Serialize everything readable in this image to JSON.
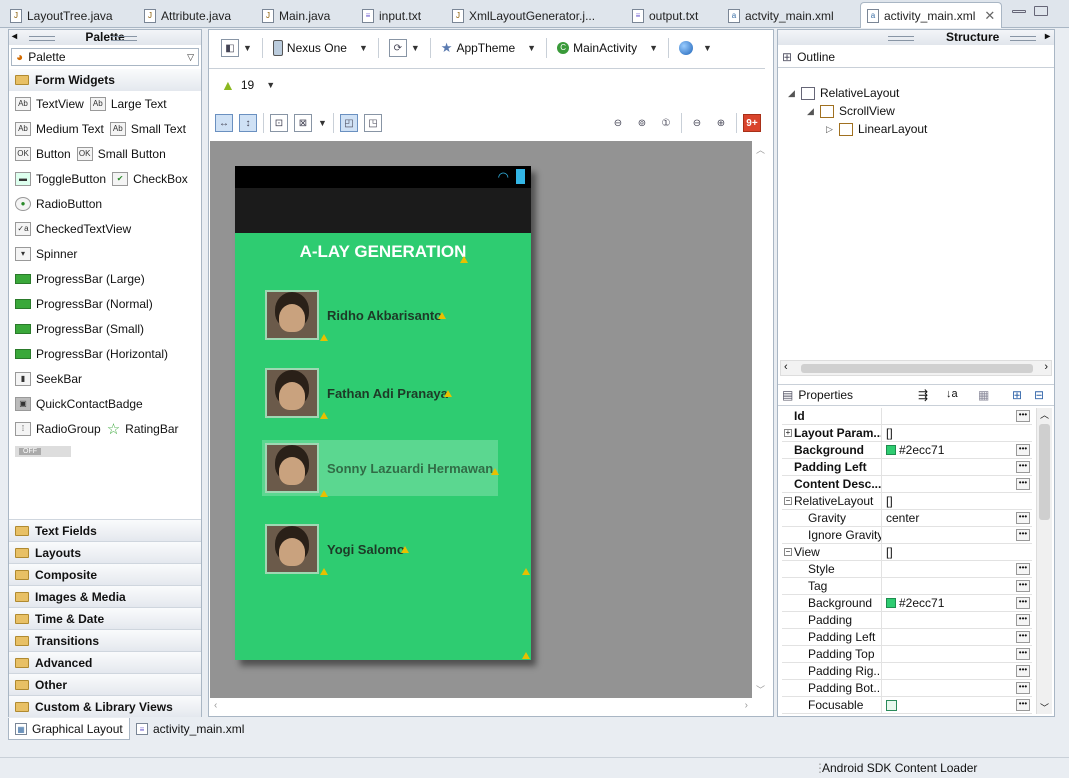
{
  "tabs": [
    {
      "label": "LayoutTree.java",
      "icon": "java-file-icon"
    },
    {
      "label": "Attribute.java",
      "icon": "java-file-icon"
    },
    {
      "label": "Main.java",
      "icon": "java-file-icon"
    },
    {
      "label": "input.txt",
      "icon": "text-file-icon"
    },
    {
      "label": "XmlLayoutGenerator.j...",
      "icon": "java-file-icon"
    },
    {
      "label": "output.txt",
      "icon": "text-file-icon"
    },
    {
      "label": "actvity_main.xml",
      "icon": "xml-file-icon"
    },
    {
      "label": "activity_main.xml",
      "icon": "xml-file-icon",
      "active": true
    }
  ],
  "palette": {
    "title": "Palette",
    "dropdown": "Palette",
    "active_category": "Form Widgets",
    "widgets": [
      [
        "TextView",
        "Large Text"
      ],
      [
        "Medium Text",
        "Small Text"
      ],
      [
        "Button",
        "Small Button"
      ],
      [
        "ToggleButton",
        "CheckBox"
      ],
      [
        "RadioButton"
      ],
      [
        "CheckedTextView"
      ],
      [
        "Spinner"
      ],
      [
        "ProgressBar (Large)"
      ],
      [
        "ProgressBar (Normal)"
      ],
      [
        "ProgressBar (Small)"
      ],
      [
        "ProgressBar (Horizontal)"
      ],
      [
        "SeekBar"
      ],
      [
        "QuickContactBadge"
      ],
      [
        "RadioGroup",
        "RatingBar"
      ]
    ],
    "switch_label": "OFF",
    "categories": [
      "Text Fields",
      "Layouts",
      "Composite",
      "Images & Media",
      "Time & Date",
      "Transitions",
      "Advanced",
      "Other",
      "Custom & Library Views"
    ]
  },
  "editor": {
    "device": "Nexus One",
    "theme": "AppTheme",
    "activity": "MainActivity",
    "api_level": "19",
    "badge": "9+"
  },
  "phone": {
    "app_title": "A-LAY GENERATION",
    "background": "#2ecc71",
    "people": [
      {
        "name": "Ridho Akbarisanto"
      },
      {
        "name": "Fathan Adi Pranaya"
      },
      {
        "name": "Sonny Lazuardi Hermawan",
        "selected": true
      },
      {
        "name": "Yogi Salomo"
      }
    ]
  },
  "structure": {
    "title": "Structure",
    "outline_title": "Outline",
    "tree": [
      {
        "label": "RelativeLayout",
        "depth": 0
      },
      {
        "label": "ScrollView",
        "depth": 1
      },
      {
        "label": "LinearLayout",
        "depth": 2
      }
    ]
  },
  "properties": {
    "title": "Properties",
    "rows": [
      {
        "key": "Id",
        "value": "",
        "bold": true
      },
      {
        "key": "Layout Param...",
        "value": "[]",
        "bold": true,
        "expand": "+"
      },
      {
        "key": "Background",
        "value": "#2ecc71",
        "bold": true,
        "swatch": true
      },
      {
        "key": "Padding Left",
        "value": "",
        "bold": true
      },
      {
        "key": "Content Desc...",
        "value": "",
        "bold": true
      },
      {
        "key": "RelativeLayout",
        "value": "[]",
        "expand": "-"
      },
      {
        "key": "Gravity",
        "value": "center",
        "indent": true
      },
      {
        "key": "Ignore Gravity",
        "value": "",
        "indent": true
      },
      {
        "key": "View",
        "value": "[]",
        "expand": "-"
      },
      {
        "key": "Style",
        "value": "",
        "indent": true
      },
      {
        "key": "Tag",
        "value": "",
        "indent": true
      },
      {
        "key": "Background",
        "value": "#2ecc71",
        "indent": true,
        "swatch": true
      },
      {
        "key": "Padding",
        "value": "",
        "indent": true
      },
      {
        "key": "Padding Left",
        "value": "",
        "indent": true
      },
      {
        "key": "Padding Top",
        "value": "",
        "indent": true
      },
      {
        "key": "Padding Rig...",
        "value": "",
        "indent": true
      },
      {
        "key": "Padding Bot...",
        "value": "",
        "indent": true
      },
      {
        "key": "Focusable",
        "value": "",
        "indent": true,
        "checkbox": true
      }
    ]
  },
  "bottom_tabs": [
    "Graphical Layout",
    "activity_main.xml"
  ],
  "status": "Android SDK Content Loader"
}
